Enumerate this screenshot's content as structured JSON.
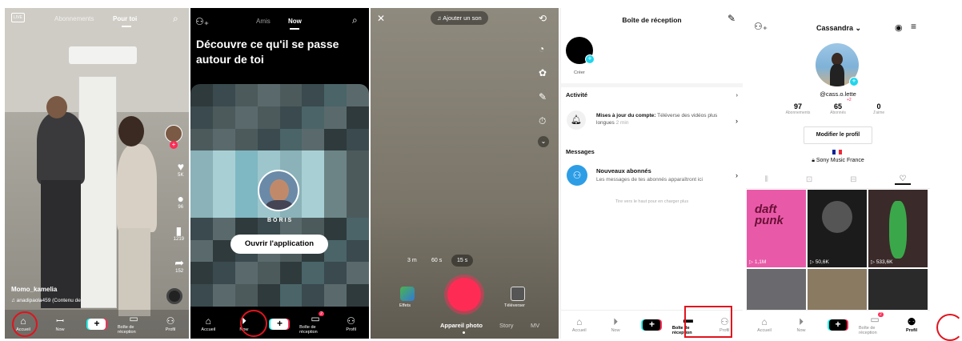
{
  "colors": {
    "accent": "#fe2c55",
    "annotation": "#e0141e",
    "cyan": "#25f4ee"
  },
  "screen1": {
    "live": "LIVE",
    "tab_following": "Abonnements",
    "tab_foryou": "Pour toi",
    "counts": {
      "likes": "5K",
      "comments": "96",
      "saves": "1219",
      "shares": "152"
    },
    "username": "Momo_kamelia",
    "sound": "♫ anadipaola459 (Contenu de",
    "nav": [
      "Accueil",
      "Now",
      "",
      "Boîte de réception",
      "Profil"
    ]
  },
  "screen2": {
    "tab_friends": "Amis",
    "tab_now": "Now",
    "headline": "Découvre ce qu'il se passe autour de toi",
    "friend_name": "BORIS",
    "open_app": "Ouvrir l'application",
    "nav": [
      "Accueil",
      "Now",
      "",
      "Boîte de réception",
      "Profil"
    ],
    "inbox_badge": "2"
  },
  "screen3": {
    "add_sound": "♫ Ajouter un son",
    "durations": [
      "3 m",
      "60 s",
      "15 s"
    ],
    "effects": "Effets",
    "upload": "Téléverser",
    "modes": [
      "Appareil photo",
      "Story",
      "MV"
    ]
  },
  "screen4": {
    "title": "Boîte de réception",
    "create": "Créer",
    "activity_header": "Activité",
    "activity_title": "Mises à jour du compte:",
    "activity_text": "Téléverse des vidéos plus longues",
    "activity_time": "2 min",
    "messages_header": "Messages",
    "msg_title": "Nouveaux abonnés",
    "msg_text": "Les messages de tes abonnés apparaîtront ici",
    "pull_hint": "Tire vers le haut pour en charger plus",
    "nav": [
      "Accueil",
      "Now",
      "",
      "Boîte de réception",
      "Profil"
    ]
  },
  "screen5": {
    "username": "Cassandra",
    "handle": "@cass.o.lette",
    "stats": [
      {
        "value": "97",
        "label": "Abonnements"
      },
      {
        "value": "65",
        "label": "Abonnés"
      },
      {
        "value": "0",
        "label": "J'aime"
      }
    ],
    "badge": "+2",
    "edit_profile": "Modifier le profil",
    "bio": "Sony Music France",
    "views": [
      "1,1M",
      "50,6K",
      "533,6K"
    ],
    "daft_punk": "daft punk",
    "nav": [
      "Accueil",
      "Now",
      "",
      "Boîte de réception",
      "Profil"
    ],
    "inbox_badge": "2"
  }
}
